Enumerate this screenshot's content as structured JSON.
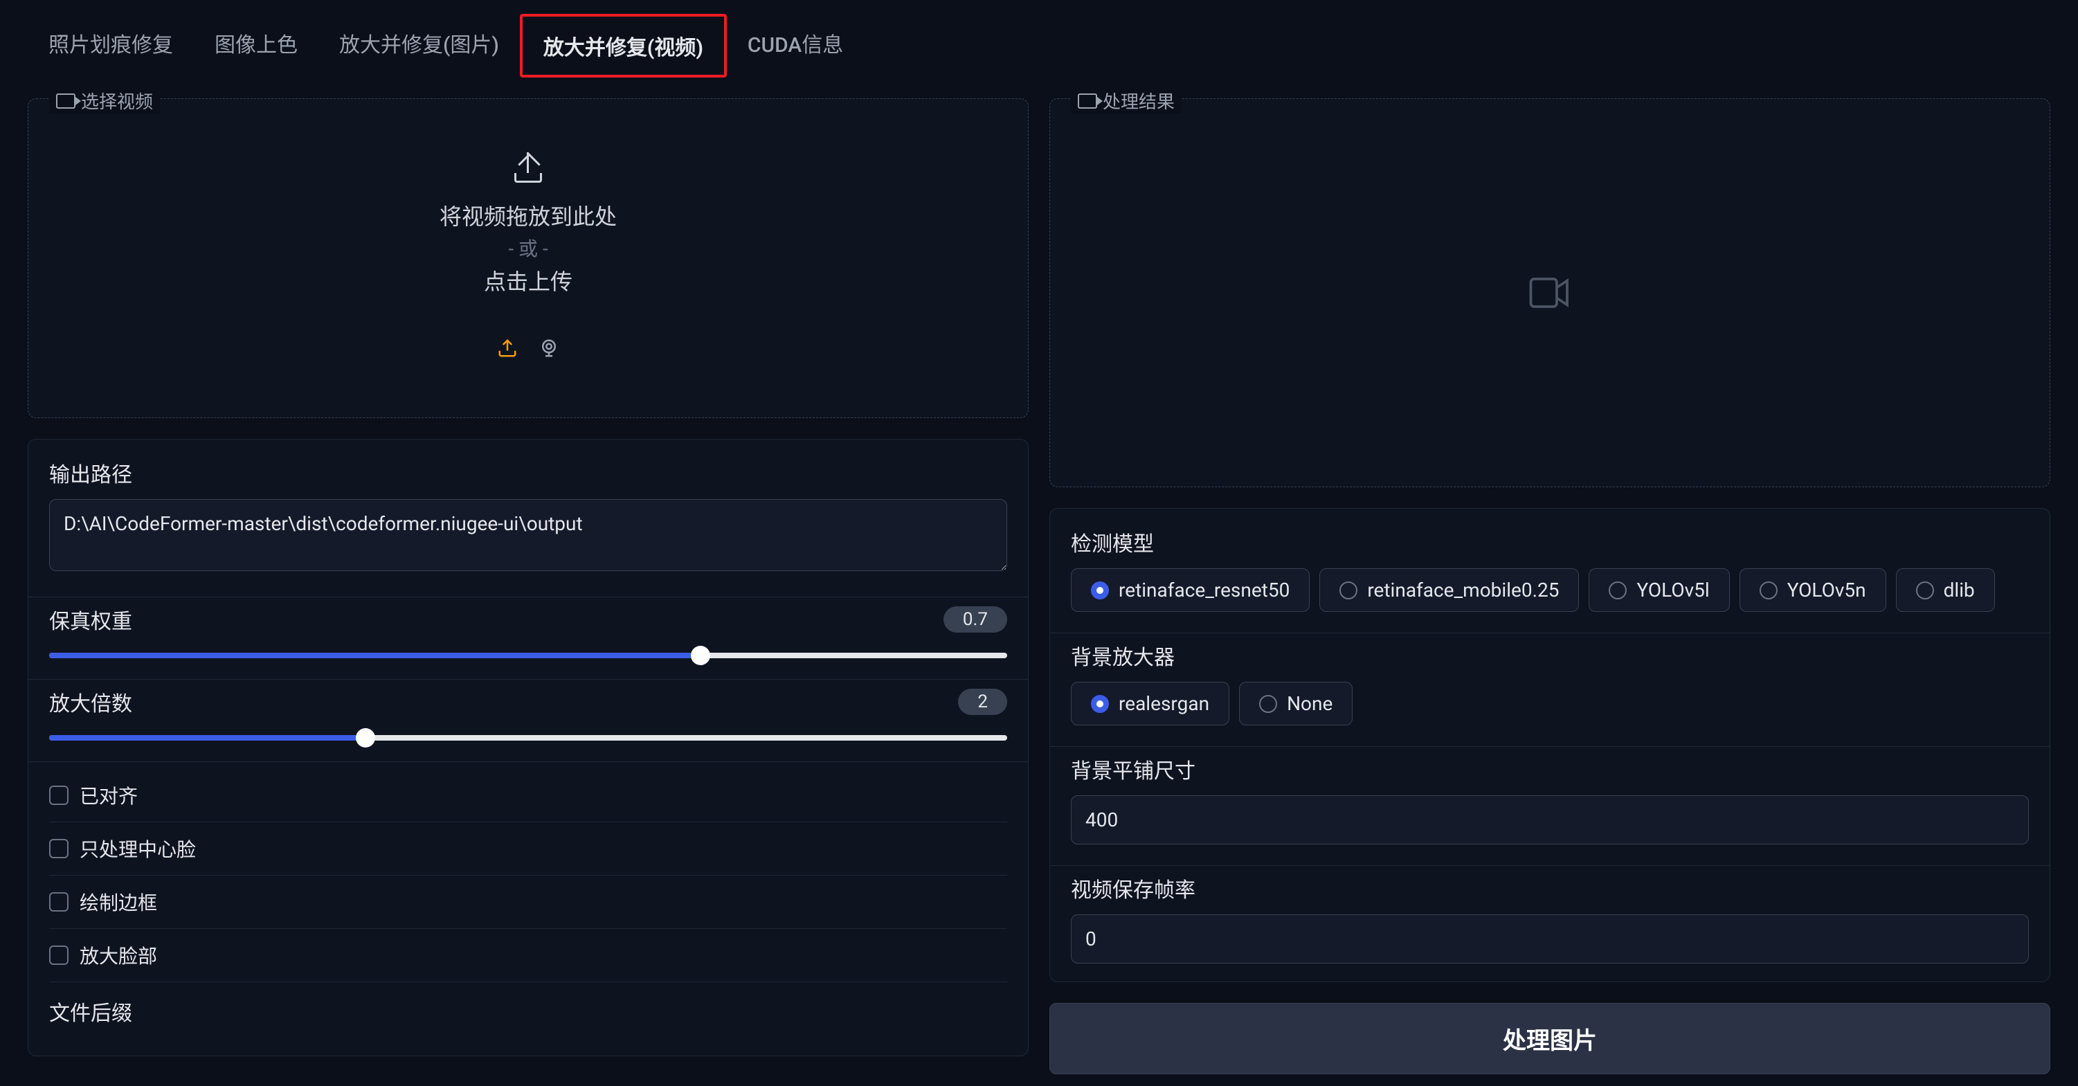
{
  "tabs": [
    {
      "label": "照片划痕修复"
    },
    {
      "label": "图像上色"
    },
    {
      "label": "放大并修复(图片)"
    },
    {
      "label": "放大并修复(视频)"
    },
    {
      "label": "CUDA信息"
    }
  ],
  "active_tab_index": 3,
  "left": {
    "select_video_label": "选择视频",
    "upload_line1": "将视频拖放到此处",
    "upload_or": "- 或 -",
    "upload_line2": "点击上传",
    "output_path_label": "输出路径",
    "output_path_value": "D:\\AI\\CodeFormer-master\\dist\\codeformer.niugee-ui\\output",
    "fidelity_label": "保真权重",
    "fidelity_value": "0.7",
    "fidelity_percent": 68,
    "upscale_label": "放大倍数",
    "upscale_value": "2",
    "upscale_percent": 33,
    "cb_aligned": "已对齐",
    "cb_center_face": "只处理中心脸",
    "cb_draw_box": "绘制边框",
    "cb_upscale_face": "放大脸部",
    "file_suffix_label": "文件后缀"
  },
  "right": {
    "result_label": "处理结果",
    "detect_model_label": "检测模型",
    "detect_models": [
      "retinaface_resnet50",
      "retinaface_mobile0.25",
      "YOLOv5l",
      "YOLOv5n",
      "dlib"
    ],
    "detect_selected_index": 0,
    "bg_upsampler_label": "背景放大器",
    "bg_upsamplers": [
      "realesrgan",
      "None"
    ],
    "bg_selected_index": 0,
    "bg_tile_label": "背景平铺尺寸",
    "bg_tile_value": "400",
    "video_fps_label": "视频保存帧率",
    "video_fps_value": "0",
    "process_button": "处理图片"
  }
}
